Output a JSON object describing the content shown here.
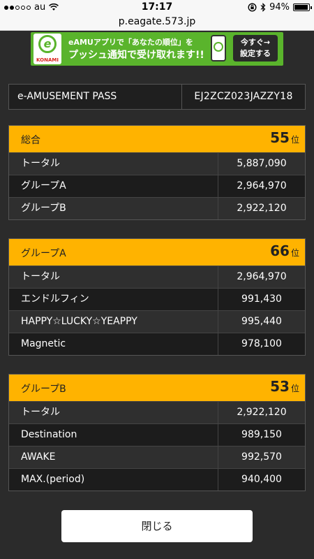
{
  "status_bar": {
    "carrier": "au",
    "signal_dots": [
      true,
      true,
      false,
      false,
      false
    ],
    "time": "17:17",
    "battery_percent": "94%",
    "battery_level": 0.94
  },
  "url_bar": {
    "url": "p.eagate.573.jp"
  },
  "banner": {
    "logo_text": "KONAMI",
    "line1": "eAMUアプリで「あなたの順位」を",
    "line2": "プッシュ通知で受け取れます!!",
    "button_line1": "今すぐ→",
    "button_line2": "設定する",
    "accent_color": "#5ab42c"
  },
  "pass": {
    "label": "e-AMUSEMENT PASS",
    "value": "EJ2ZCZ023JAZZY18"
  },
  "rankings": [
    {
      "title": "総合",
      "rank": "55",
      "suffix": "位",
      "rows": [
        {
          "label": "トータル",
          "value": "5,887,090"
        },
        {
          "label": "グループA",
          "value": "2,964,970"
        },
        {
          "label": "グループB",
          "value": "2,922,120"
        }
      ]
    },
    {
      "title": "グループA",
      "rank": "66",
      "suffix": "位",
      "rows": [
        {
          "label": "トータル",
          "value": "2,964,970"
        },
        {
          "label": "エンドルフィン",
          "value": "991,430"
        },
        {
          "label": "HAPPY☆LUCKY☆YEAPPY",
          "value": "995,440"
        },
        {
          "label": "Magnetic",
          "value": "978,100"
        }
      ]
    },
    {
      "title": "グループB",
      "rank": "53",
      "suffix": "位",
      "rows": [
        {
          "label": "トータル",
          "value": "2,922,120"
        },
        {
          "label": "Destination",
          "value": "989,150"
        },
        {
          "label": "AWAKE",
          "value": "992,570"
        },
        {
          "label": "MAX.(period)",
          "value": "940,400"
        }
      ]
    }
  ],
  "close_button": {
    "label": "閉じる"
  },
  "colors": {
    "header_accent": "#ffb300",
    "background": "#2b2b2b"
  }
}
